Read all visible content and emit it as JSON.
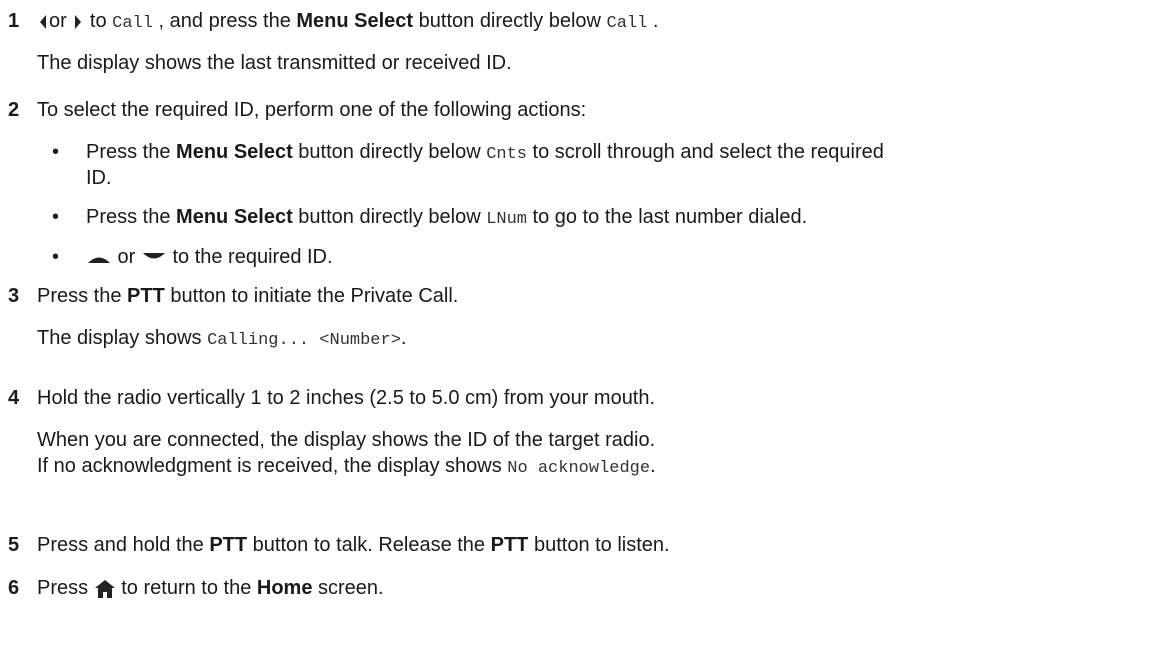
{
  "steps": [
    {
      "number": "1",
      "a_or": "or",
      "a_to": " to ",
      "a_code": "Call",
      "a_mid": " , and press the ",
      "a_bold": "Menu Select",
      "a_after": " button directly below ",
      "a_code2": "Call",
      "a_end": " .",
      "note": "The display shows the last transmitted or received ID."
    },
    {
      "number": "2",
      "text": "To select the required ID, perform one of the following actions:",
      "bullets": [
        {
          "pre": "Press the ",
          "bold": "Menu Select",
          "mid": " button directly below ",
          "code": "Cnts",
          "post": " to scroll through and select the required",
          "wrap": "ID."
        },
        {
          "pre": "Press the ",
          "bold": "Menu Select",
          "mid": " button directly below ",
          "code": "LNum",
          "post": " to go to the last number dialed."
        },
        {
          "or": " or ",
          "post": " to the required ID."
        }
      ]
    },
    {
      "number": "3",
      "pre": "Press the ",
      "bold": "PTT",
      "post": " button to initiate the Private Call.",
      "note_pre": "The display shows ",
      "note_code": "Calling... <Number>",
      "note_post": "."
    },
    {
      "number": "4",
      "text": "Hold the radio vertically 1 to 2 inches (2.5 to 5.0 cm) from your mouth.",
      "note1": "When you are connected, the display shows the ID of the target radio.",
      "note2_pre": "If no acknowledgment is received, the display shows ",
      "note2_code": "No acknowledge",
      "note2_post": "."
    },
    {
      "number": "5",
      "pre": "Press and hold the ",
      "bold1": "PTT",
      "mid": " button to talk. Release the ",
      "bold2": "PTT",
      "post": " button to listen."
    },
    {
      "number": "6",
      "pre": "Press ",
      "post": " to return to the ",
      "bold": "Home",
      "end": " screen."
    }
  ],
  "icons": {
    "left": "left-arrow-icon",
    "right": "right-arrow-icon",
    "up": "up-arrow-icon",
    "down": "down-arrow-icon",
    "home": "home-icon"
  }
}
